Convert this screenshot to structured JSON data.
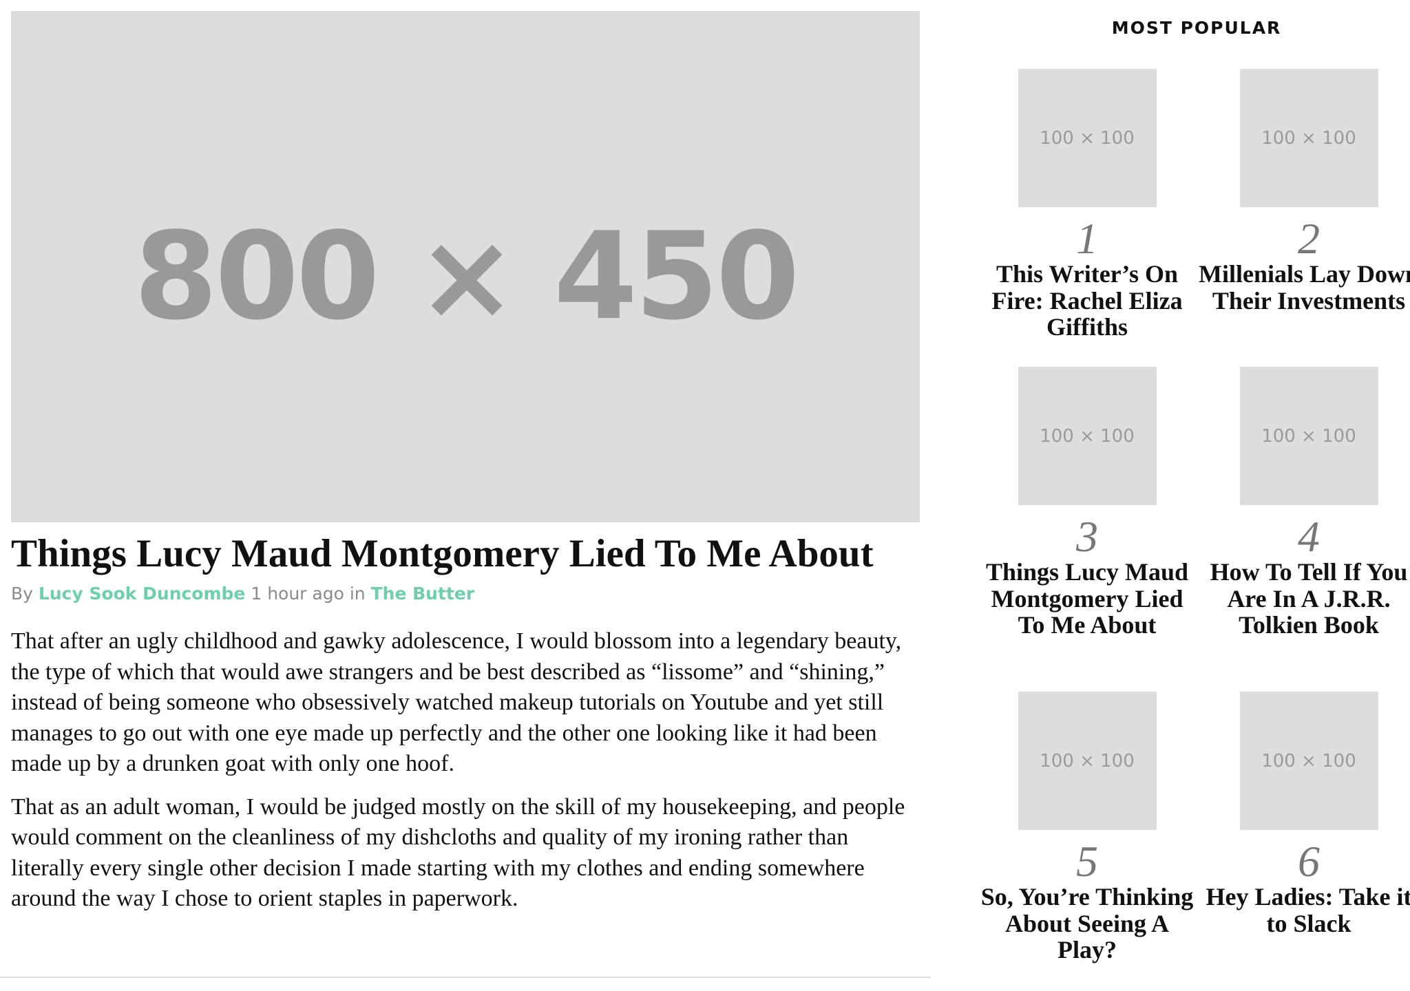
{
  "hero": {
    "placeholder_label": "800 × 450"
  },
  "article": {
    "title": "Things Lucy Maud Montgomery Lied To Me About",
    "byline": {
      "by": "By",
      "author": "Lucy Sook Duncombe",
      "time": "1 hour ago",
      "in": "in",
      "category": "The Butter"
    },
    "paragraphs": [
      "That after an ugly childhood and gawky adolescence, I would blossom into a legendary beauty, the type of which that would awe strangers and be best described as “lissome” and “shining,” instead of being someone who obsessively watched makeup tutorials on Youtube and yet still manages to go out with one eye made up perfectly and the other one looking like it had been made up by a drunken goat with only one hoof.",
      "That as an adult woman, I would be judged mostly on the skill of my housekeeping, and people would comment on the cleanliness of my dishcloths and quality of my ironing rather than literally every single other decision I made starting with my clothes and ending somewhere around the way I chose to orient staples in paperwork."
    ]
  },
  "sidebar": {
    "heading": "MOST POPULAR",
    "items": [
      {
        "thumb": "100 × 100",
        "rank": "1",
        "title": "This Writer’s On Fire: Rachel Eliza Giffiths"
      },
      {
        "thumb": "100 × 100",
        "rank": "2",
        "title": "Millenials Lay Down Their Investments"
      },
      {
        "thumb": "100 × 100",
        "rank": "3",
        "title": "Things Lucy Maud Montgomery Lied To Me About"
      },
      {
        "thumb": "100 × 100",
        "rank": "4",
        "title": "How To Tell If You Are In A J.R.R. Tolkien Book"
      },
      {
        "thumb": "100 × 100",
        "rank": "5",
        "title": "So, You’re Thinking About Seeing A Play?"
      },
      {
        "thumb": "100 × 100",
        "rank": "6",
        "title": "Hey Ladies: Take it to Slack"
      }
    ]
  },
  "colors": {
    "accent": "#6ecfae",
    "placeholder_bg": "#dddddd",
    "placeholder_text": "#999999",
    "rank_text": "#777777"
  }
}
